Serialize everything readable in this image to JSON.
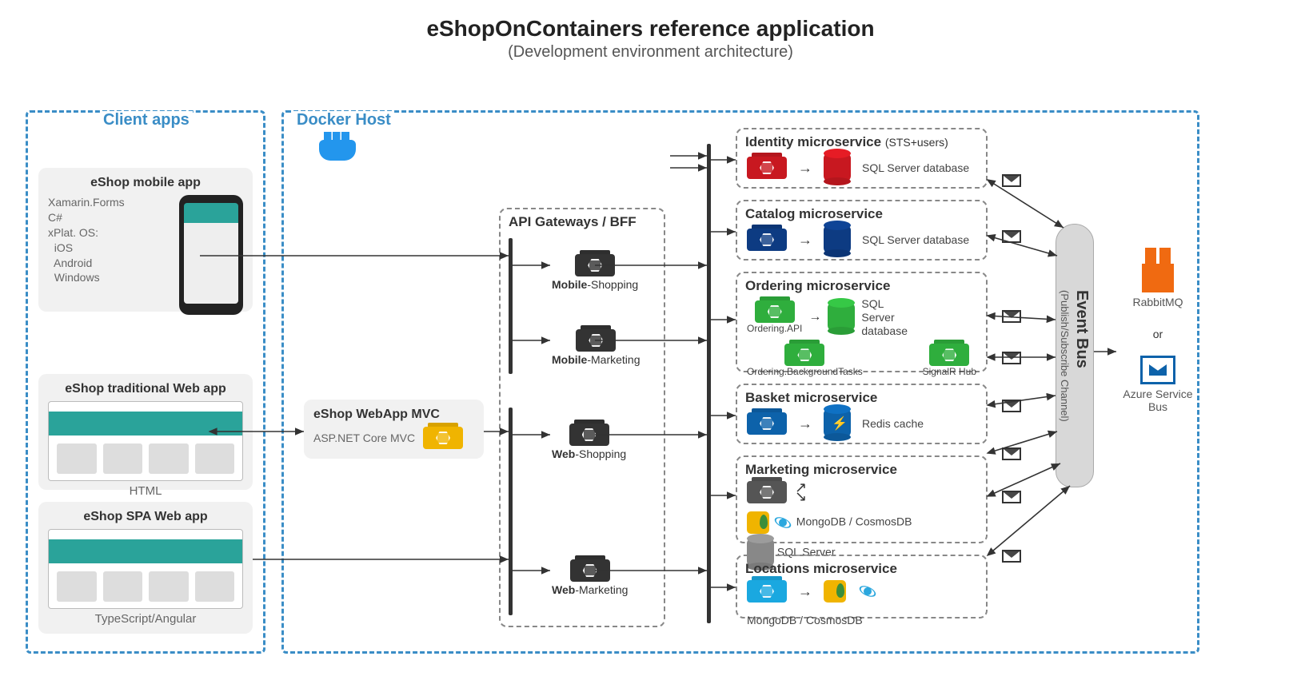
{
  "title": "eShopOnContainers reference application",
  "subtitle": "(Development environment architecture)",
  "regions": {
    "client_apps": "Client apps",
    "docker_host": "Docker Host"
  },
  "clients": {
    "mobile": {
      "title": "eShop mobile app",
      "lines": [
        "Xamarin.Forms",
        "C#",
        "xPlat. OS:",
        "  iOS",
        "  Android",
        "  Windows"
      ]
    },
    "traditional": {
      "title": "eShop traditional Web app",
      "footer": "HTML"
    },
    "spa": {
      "title": "eShop SPA Web app",
      "footer": "TypeScript/Angular"
    }
  },
  "webapp_mvc": {
    "title": "eShop WebApp MVC",
    "tech": "ASP.NET Core MVC"
  },
  "api_gateways": {
    "title": "API Gateways / BFF",
    "items": [
      {
        "bold": "Mobile",
        "rest": "-Shopping"
      },
      {
        "bold": "Mobile",
        "rest": "-Marketing"
      },
      {
        "bold": "Web",
        "rest": "-Shopping"
      },
      {
        "bold": "Web",
        "rest": "-Marketing"
      }
    ]
  },
  "microservices": {
    "identity": {
      "title": "Identity microservice",
      "note": "(STS+users)",
      "store": "SQL Server database"
    },
    "catalog": {
      "title": "Catalog microservice",
      "store": "SQL Server database"
    },
    "ordering": {
      "title": "Ordering microservice",
      "api": "Ordering.API",
      "bg": "Ordering.BackgroundTasks",
      "store": "SQL Server database",
      "signalr": "SignalR Hub"
    },
    "basket": {
      "title": "Basket microservice",
      "store": "Redis cache"
    },
    "marketing": {
      "title": "Marketing microservice",
      "store1": "MongoDB / CosmosDB",
      "store2": "SQL Server"
    },
    "locations": {
      "title": "Locations microservice",
      "store": "MongoDB / CosmosDB"
    }
  },
  "event_bus": {
    "label": "Event Bus",
    "sublabel": "(Publish/Subscribe Channel)"
  },
  "bus_impl": {
    "rabbit": "RabbitMQ",
    "or": "or",
    "azure": "Azure Service Bus"
  },
  "colors": {
    "identity": "#c81820",
    "catalog": "#0d3b82",
    "ordering": "#2fae3d",
    "basket": "#0d62aa",
    "marketing": "#555",
    "locations": "#1aa8e0",
    "gateway": "#333",
    "mvc": "#f0b400",
    "redis": "#0d62aa",
    "sqlgrey": "#888"
  }
}
